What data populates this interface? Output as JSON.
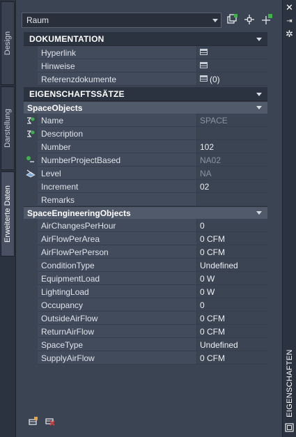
{
  "palette_title": "EIGENSCHAFTEN",
  "tabs": [
    {
      "label": "Design",
      "active": false
    },
    {
      "label": "Darstellung",
      "active": false
    },
    {
      "label": "Erweiterte Daten",
      "active": true
    }
  ],
  "object_type": "Raum",
  "icons": {
    "close": "close-icon",
    "autohide": "autohide-icon",
    "settings": "gear-icon",
    "quick_select": "quick-select-icon",
    "select_objects": "select-objects-icon",
    "toggle_pickadd": "pickadd-icon"
  },
  "documentation": {
    "header": "DOKUMENTATION",
    "rows": [
      {
        "name": "Hyperlink",
        "type": "button"
      },
      {
        "name": "Hinweise",
        "type": "button"
      },
      {
        "name": "Referenzdokumente",
        "type": "button",
        "count": "(0)"
      }
    ]
  },
  "property_sets": {
    "header": "EIGENSCHAFTSSÄTZE",
    "space_objects": {
      "header": "SpaceObjects",
      "rows": [
        {
          "name": "Name",
          "value": "SPACE",
          "dim": true,
          "icon": "formula-icon"
        },
        {
          "name": "Description",
          "value": "",
          "icon": "formula-icon"
        },
        {
          "name": "Number",
          "value": "102"
        },
        {
          "name": "NumberProjectBased",
          "value": "NA02",
          "dim": true,
          "icon": "auto-number-icon"
        },
        {
          "name": "Level",
          "value": "NA",
          "dim": true,
          "icon": "level-icon"
        },
        {
          "name": "Increment",
          "value": "02"
        },
        {
          "name": "Remarks",
          "value": ""
        }
      ]
    },
    "space_engineering": {
      "header": "SpaceEngineeringObjects",
      "rows": [
        {
          "name": "AirChangesPerHour",
          "value": "0"
        },
        {
          "name": "AirFlowPerArea",
          "value": "0 CFM"
        },
        {
          "name": "AirFlowPerPerson",
          "value": "0 CFM"
        },
        {
          "name": "ConditionType",
          "value": "Undefined"
        },
        {
          "name": "EquipmentLoad",
          "value": "0 W"
        },
        {
          "name": "LightingLoad",
          "value": "0 W"
        },
        {
          "name": "Occupancy",
          "value": "0"
        },
        {
          "name": "OutsideAirFlow",
          "value": "0 CFM"
        },
        {
          "name": "ReturnAirFlow",
          "value": "0 CFM"
        },
        {
          "name": "SpaceType",
          "value": "Undefined"
        },
        {
          "name": "SupplyAirFlow",
          "value": "0 CFM"
        }
      ]
    }
  },
  "bottom_actions": [
    "add-property-set-icon",
    "remove-property-set-icon"
  ],
  "colors": {
    "background": "#3b4453",
    "accent_green": "#3fb34a",
    "accent_red": "#d23b3b"
  }
}
